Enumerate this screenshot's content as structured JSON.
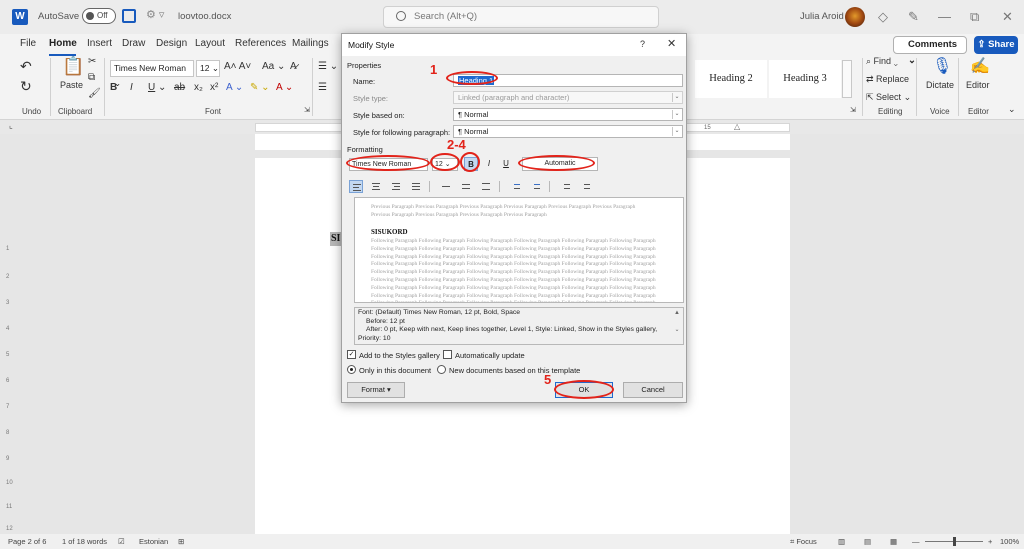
{
  "titlebar": {
    "logo": "W",
    "autosave_label": "AutoSave",
    "autosave_state": "Off",
    "filename": "loovtoo.docx",
    "search_placeholder": "Search (Alt+Q)",
    "user_name": "Julia Aroid",
    "minimize": "—",
    "restore": "⧉",
    "close": "✕"
  },
  "ribbon": {
    "tabs": [
      "File",
      "Home",
      "Insert",
      "Draw",
      "Design",
      "Layout",
      "References",
      "Mailings"
    ],
    "comments_label": "Comments",
    "share_label": "Share",
    "undo_label": "Undo",
    "clipboard_label": "Clipboard",
    "paste_label": "Paste",
    "font_label": "Font",
    "font_name": "Times New Roman",
    "font_size": "12",
    "style_heading2": "Heading 2",
    "style_heading3": "Heading 3",
    "find_label": "Find",
    "replace_label": "Replace",
    "select_label": "Select",
    "editing_label": "Editing",
    "dictate_label": "Dictate",
    "voice_label": "Voice",
    "editor_label": "Editor",
    "editor_group_label": "Editor"
  },
  "ruler": {
    "marker_15": "15"
  },
  "document": {
    "heading_fragment": "SIS"
  },
  "statusbar": {
    "page": "Page 2 of 6",
    "words": "1 of 18 words",
    "language": "Estonian",
    "focus": "Focus",
    "zoom": "100%"
  },
  "dialog": {
    "title": "Modify Style",
    "help": "?",
    "close": "✕",
    "properties_label": "Properties",
    "name_label": "Name:",
    "name_value": "Heading 1",
    "style_type_label": "Style type:",
    "style_type_value": "Linked (paragraph and character)",
    "based_on_label": "Style based on:",
    "based_on_value": "¶  Normal",
    "following_label": "Style for following paragraph:",
    "following_value": "¶  Normal",
    "formatting_label": "Formatting",
    "font_value": "Times New Roman",
    "size_value": "12",
    "bold": "B",
    "italic": "I",
    "underline": "U",
    "color_value": "Automatic",
    "preview_previous": "Previous Paragraph Previous Paragraph Previous Paragraph Previous Paragraph Previous Paragraph Previous Paragraph Previous Paragraph Previous Paragraph Previous Paragraph Previous Paragraph",
    "preview_heading": "SISUKORD",
    "preview_following": "Following Paragraph Following Paragraph Following Paragraph Following Paragraph Following Paragraph Following Paragraph Following Paragraph Following Paragraph Following Paragraph Following Paragraph Following Paragraph Following Paragraph Following Paragraph Following Paragraph Following Paragraph Following Paragraph Following Paragraph Following Paragraph Following Paragraph Following Paragraph Following Paragraph Following Paragraph Following Paragraph Following Paragraph Following Paragraph Following Paragraph Following Paragraph Following Paragraph Following Paragraph Following Paragraph Following Paragraph Following Paragraph Following Paragraph Following Paragraph Following Paragraph Following Paragraph Following Paragraph Following Paragraph Following Paragraph Following Paragraph Following Paragraph Following Paragraph Following Paragraph Following Paragraph Following Paragraph Following Paragraph Following Paragraph Following Paragraph Following Paragraph Following Paragraph Following Paragraph Following Paragraph Following Paragraph Following Paragraph Following Paragraph Following Paragraph",
    "description_line1": "Font: (Default) Times New Roman, 12 pt, Bold, Space",
    "description_line2": "Before:  12 pt",
    "description_line3": "After:  0 pt, Keep with next, Keep lines together, Level 1, Style: Linked, Show in the Styles gallery,",
    "description_line4": "Priority: 10",
    "add_gallery_label": "Add to the Styles gallery",
    "auto_update_label": "Automatically update",
    "only_doc_label": "Only in this document",
    "new_docs_label": "New documents based on this template",
    "format_button": "Format ▾",
    "ok_button": "OK",
    "cancel_button": "Cancel"
  },
  "annotations": {
    "step1": "1",
    "step2_4": "2-4",
    "step5": "5",
    "color": "#e2231a"
  }
}
